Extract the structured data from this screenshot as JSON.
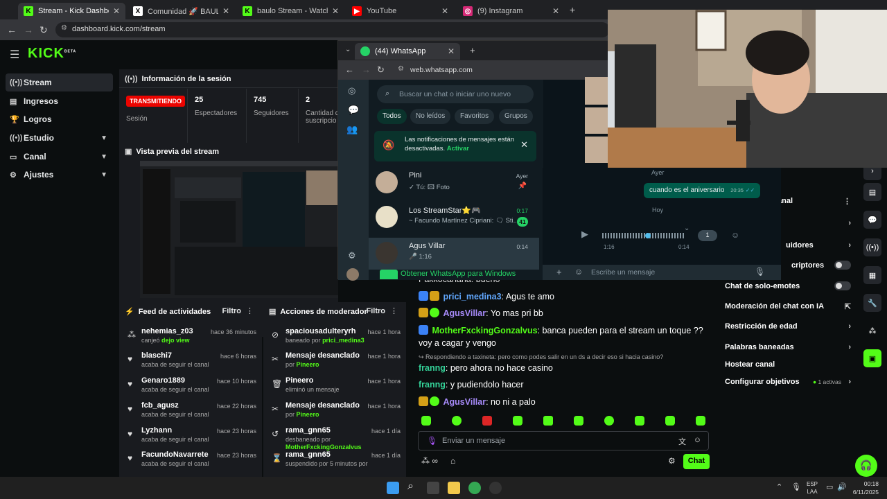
{
  "browser": {
    "tabs": [
      {
        "title": "Stream - Kick Dashboard",
        "active": true
      },
      {
        "title": "Comunidad 🚀 BAULO CLUB 🚀",
        "active": false
      },
      {
        "title": "baulo Stream - Watch Live on Kick",
        "active": false
      },
      {
        "title": "YouTube",
        "active": false
      },
      {
        "title": "(9) Instagram",
        "active": false
      }
    ],
    "new_tab": "+",
    "url": "dashboard.kick.com/stream"
  },
  "kick": {
    "logo": "KICK",
    "logo_beta": "BETA",
    "nav": [
      {
        "label": "Stream",
        "icon": "stream-icon",
        "active": true
      },
      {
        "label": "Ingresos",
        "icon": "revenue-icon"
      },
      {
        "label": "Logros",
        "icon": "trophy-icon"
      },
      {
        "label": "Estudio",
        "icon": "studio-icon",
        "expandable": true
      },
      {
        "label": "Canal",
        "icon": "channel-icon",
        "expandable": true
      },
      {
        "label": "Ajustes",
        "icon": "gear-icon",
        "expandable": true
      }
    ],
    "session": {
      "title": "Información de la sesión",
      "status": "TRANSMITIENDO",
      "status_label": "Sesión",
      "stats": [
        {
          "value": "25",
          "label": "Espectadores"
        },
        {
          "value": "745",
          "label": "Seguidores"
        },
        {
          "value": "2",
          "label": "Cantidad de suscripcio"
        }
      ]
    },
    "preview": {
      "title": "Vista previa del stream"
    },
    "activity": {
      "title": "Feed de actividades",
      "filter": "Filtro",
      "items": [
        {
          "user": "nehemias_z03",
          "text": "canjeó",
          "highlight": "dejo view",
          "time": "hace 36 minutos"
        },
        {
          "user": "blaschi7",
          "text": "acaba de seguir el canal",
          "time": "hace 6 horas"
        },
        {
          "user": "Genaro1889",
          "text": "acaba de seguir el canal",
          "time": "hace 10 horas"
        },
        {
          "user": "fcb_agusz",
          "text": "acaba de seguir el canal",
          "time": "hace 22 horas"
        },
        {
          "user": "Lyzhann",
          "text": "acaba de seguir el canal",
          "time": "hace 23 horas"
        },
        {
          "user": "FacundoNavarrete",
          "text": "acaba de seguir el canal",
          "time": "hace 23 horas"
        }
      ]
    },
    "mod": {
      "title": "Acciones de moderador",
      "filter": "Filtro",
      "items": [
        {
          "user": "spaciousadulteryrh",
          "text": "baneado por",
          "by": "prici_medina3",
          "time": "hace 1 hora"
        },
        {
          "user": "Mensaje desanclado",
          "text": "por",
          "by": "Pineero",
          "time": "hace 1 hora"
        },
        {
          "user": "Pineero",
          "text": "eliminó un mensaje",
          "by": "",
          "time": "hace 1 hora"
        },
        {
          "user": "Mensaje desanclado",
          "text": "por",
          "by": "Pineero",
          "time": "hace 1 hora"
        },
        {
          "user": "rama_gnn65",
          "text": "desbaneado por",
          "by": "MotherFxckingGonzalvus",
          "time": "hace 1 día"
        },
        {
          "user": "rama_gnn65",
          "text": "suspendido por 5 minutos por",
          "by": "",
          "time": "hace 1 día"
        }
      ]
    },
    "chat": {
      "partial_top": "Pakkocanana: bueno",
      "messages": [
        {
          "user": "prici_medina3",
          "color": "#60a5fa",
          "text": "Agus te amo"
        },
        {
          "user": "AgusVillar",
          "color": "#a78bfa",
          "text": "Yo mas pri bb"
        },
        {
          "user": "MotherFxckingGonzalvus",
          "color": "#53fc18",
          "text": "banca pueden para el stream un toque ?? voy a cagar y vengo"
        },
        {
          "reply": "Respondiendo a taxineta: pero como podes salir en un ds a decir eso si hacia casino?"
        },
        {
          "user": "franng",
          "color": "#34d399",
          "text": "pero ahora no hace casino"
        },
        {
          "user": "franng",
          "color": "#34d399",
          "text": "y pudiendolo hacer"
        },
        {
          "user": "AgusVillar",
          "color": "#a78bfa",
          "text": "no ni a palo"
        }
      ],
      "placeholder": "Enviar un mensaje",
      "send": "Chat"
    },
    "settings": {
      "items": [
        {
          "label": "anal",
          "kind": "menu"
        },
        {
          "label": "",
          "kind": "chev"
        },
        {
          "label": "uidores",
          "kind": "chev"
        },
        {
          "label": "criptores",
          "kind": "toggle"
        },
        {
          "label": "Chat de solo-emotes",
          "kind": "toggle"
        },
        {
          "label": "Moderación del chat con IA",
          "kind": "ext"
        },
        {
          "label": "Restricción de edad",
          "kind": "chev"
        },
        {
          "label": "Palabras baneadas",
          "kind": "chev"
        },
        {
          "label": "Hostear canal",
          "kind": "none"
        },
        {
          "label": "Configurar objetivos",
          "kind": "goal",
          "extra": "1 activas"
        }
      ]
    }
  },
  "whatsapp": {
    "tab_title": "(44) WhatsApp",
    "url": "web.whatsapp.com",
    "search_placeholder": "Buscar un chat o iniciar uno nuevo",
    "chips": [
      "Todos",
      "No leídos",
      "Favoritos",
      "Grupos"
    ],
    "notice": "Las notificaciones de mensajes están desactivadas.",
    "notice_action": "Activar",
    "contacts": [
      {
        "name": "Pini",
        "preview": "✓ Tú: 🖾 Foto",
        "time": "Ayer"
      },
      {
        "name": "Los StreamStar⭐🎮",
        "preview": "~ Facundo Martínez Cipriani: 🗨 Sti...",
        "time": "0:17",
        "unread": "41"
      },
      {
        "name": "Agus Villar",
        "preview": "🎤 1:16",
        "time": "0:14"
      }
    ],
    "banner": "Obtener WhatsApp para Windows",
    "chat": {
      "day1": "Ayer",
      "msg": "cuando es el aniversario",
      "msg_time": "20:35",
      "day2": "Hoy",
      "audio_start": "1:16",
      "audio_end": "0:14",
      "audio_speed": "1",
      "input_placeholder": "Escribe un mensaje"
    }
  },
  "taskbar": {
    "lang": "ESP",
    "lang2": "LAA",
    "time": "00:18",
    "date": "6/11/2025"
  },
  "colors": {
    "kick_green": "#53fc18",
    "live_red": "#eb0400",
    "wa_green": "#25d366"
  }
}
